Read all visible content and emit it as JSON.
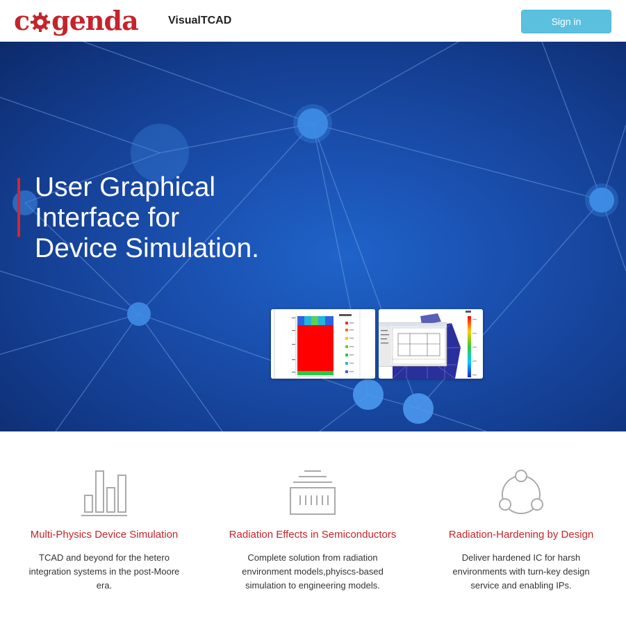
{
  "header": {
    "logo_text_before": "c",
    "logo_text_after": "genda",
    "brand": "VisualTCAD",
    "signin_label": "Sign in"
  },
  "hero": {
    "title_lines": [
      "User Graphical",
      "Interface for",
      "Device Simulation."
    ],
    "thumbnails": [
      {
        "icon": "region-plot-screenshot",
        "legend_title": "Regions"
      },
      {
        "icon": "mesh-editor-screenshot",
        "colorbar_label": "Pot"
      }
    ]
  },
  "features": [
    {
      "icon": "bar-chart-icon",
      "title": "Multi-Physics Device Simulation",
      "description": "TCAD and beyond for the hetero integration systems in the post-Moore era."
    },
    {
      "icon": "chip-icon",
      "title": "Radiation Effects in Semiconductors",
      "description": "Complete solution from radiation environment models,phyiscs-based simulation to engineering models."
    },
    {
      "icon": "network-nodes-icon",
      "title": "Radiation-Hardening by Design",
      "description": "Deliver hardened IC for harsh environments with turn-key design service and enabling IPs."
    }
  ],
  "colors": {
    "brand_red": "#c4242b",
    "signin_blue": "#5bc0de",
    "hero_blue": "#1a4fae",
    "accent_bar": "#d0292f",
    "icon_gray": "#aaaaaa"
  }
}
